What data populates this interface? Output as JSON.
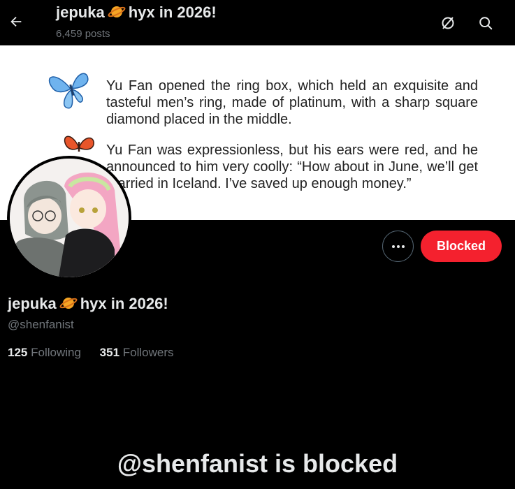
{
  "header": {
    "title_part1": "jepuka",
    "title_part2": "hyx in 2026!",
    "posts": "6,459 posts"
  },
  "banner": {
    "paragraph1": "Yu Fan opened the ring box, which held an exquisite and tasteful men’s ring, made of platinum, with a sharp square diamond placed in the middle.",
    "paragraph2": "Yu Fan was expressionless, but his ears were red, and he announced to him very coolly: “How about in June, we’ll get married in Iceland. I’ve saved up enough money.”"
  },
  "profile": {
    "name_part1": "jepuka",
    "name_part2": "hyx in 2026!",
    "handle": "@shenfanist",
    "following_count": "125",
    "following_label": "Following",
    "followers_count": "351",
    "followers_label": "Followers"
  },
  "actions": {
    "blocked_label": "Blocked"
  },
  "message": {
    "blocked_text": "@shenfanist is blocked"
  },
  "icons": {
    "back": "arrow-left-icon",
    "unblock": "unblock-icon",
    "search": "search-icon",
    "more": "more-icon",
    "planet": "ringed-planet-emoji"
  },
  "colors": {
    "background": "#000000",
    "text_primary": "#e7e9ea",
    "text_secondary": "#71767b",
    "blocked_button": "#f4212e",
    "border": "#536471"
  }
}
